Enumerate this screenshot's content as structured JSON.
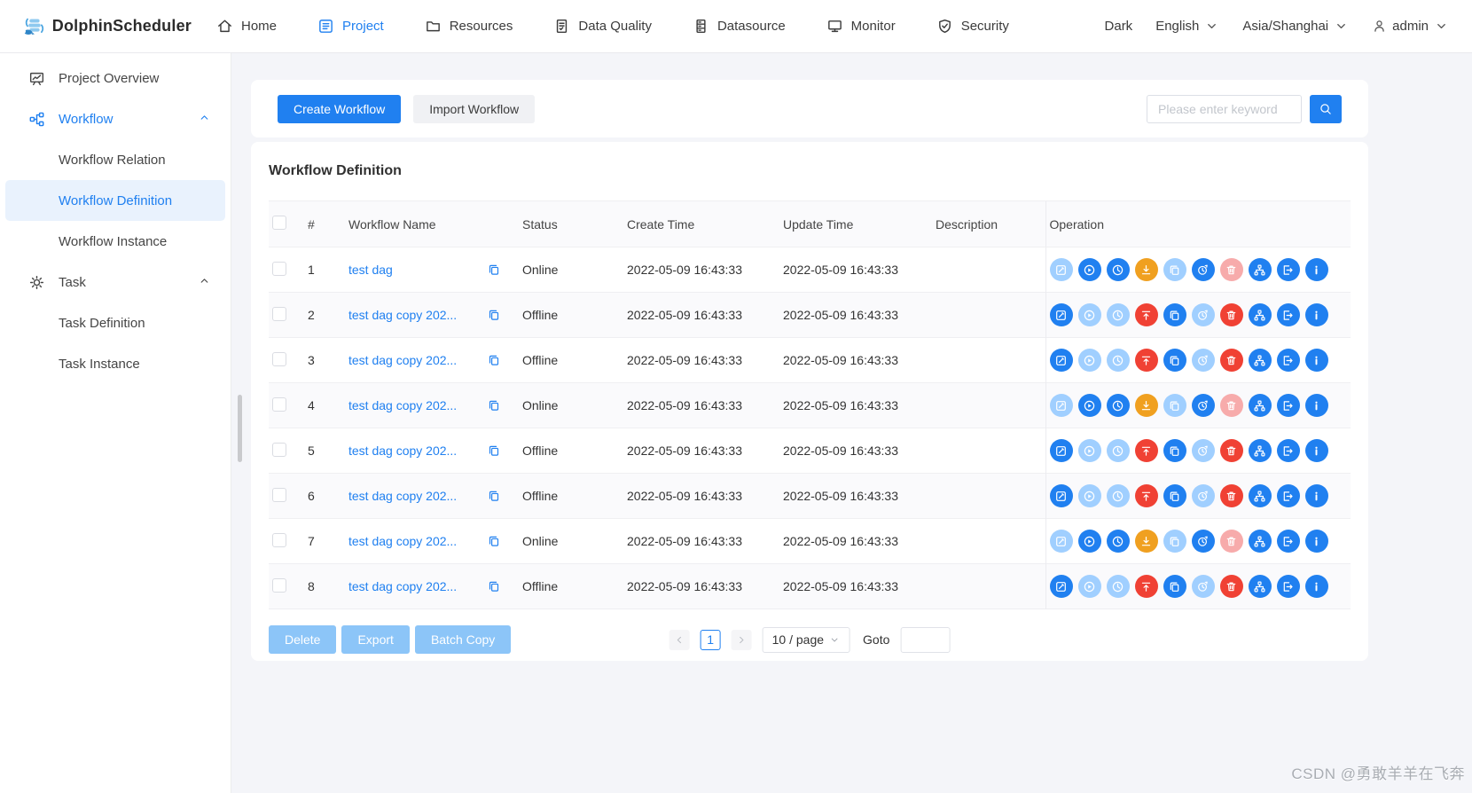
{
  "navbar": {
    "brand": "DolphinScheduler",
    "items": [
      {
        "label": "Home",
        "icon": "home-icon",
        "active": false
      },
      {
        "label": "Project",
        "icon": "project-icon",
        "active": true
      },
      {
        "label": "Resources",
        "icon": "folder-icon",
        "active": false
      },
      {
        "label": "Data Quality",
        "icon": "data-quality-icon",
        "active": false
      },
      {
        "label": "Datasource",
        "icon": "datasource-icon",
        "active": false
      },
      {
        "label": "Monitor",
        "icon": "monitor-icon",
        "active": false
      },
      {
        "label": "Security",
        "icon": "security-icon",
        "active": false
      }
    ],
    "right": {
      "theme": "Dark",
      "language": "English",
      "timezone": "Asia/Shanghai",
      "user": "admin"
    }
  },
  "sidebar": {
    "items": [
      {
        "label": "Project Overview",
        "icon": "project-overview-icon",
        "type": "top",
        "active": false,
        "section_active": false,
        "expandable": false
      },
      {
        "label": "Workflow",
        "icon": "workflow-icon",
        "type": "top",
        "active": false,
        "section_active": true,
        "expandable": true
      },
      {
        "label": "Workflow Relation",
        "type": "sub",
        "active": false
      },
      {
        "label": "Workflow Definition",
        "type": "sub",
        "active": true
      },
      {
        "label": "Workflow Instance",
        "type": "sub",
        "active": false
      },
      {
        "label": "Task",
        "icon": "task-icon",
        "type": "top",
        "active": false,
        "section_active": false,
        "expandable": true
      },
      {
        "label": "Task Definition",
        "type": "sub",
        "active": false
      },
      {
        "label": "Task Instance",
        "type": "sub",
        "active": false
      }
    ]
  },
  "toolbar": {
    "create_label": "Create Workflow",
    "import_label": "Import Workflow",
    "search_placeholder": "Please enter keyword"
  },
  "panel": {
    "title": "Workflow Definition"
  },
  "table": {
    "columns": [
      "#",
      "Workflow Name",
      "Status",
      "Create Time",
      "Update Time",
      "Description",
      "Operation"
    ],
    "rows": [
      {
        "index": "1",
        "name": "test dag",
        "status": "Online",
        "create_time": "2022-05-09 16:43:33",
        "update_time": "2022-05-09 16:43:33",
        "description": ""
      },
      {
        "index": "2",
        "name": "test dag copy 202...",
        "status": "Offline",
        "create_time": "2022-05-09 16:43:33",
        "update_time": "2022-05-09 16:43:33",
        "description": ""
      },
      {
        "index": "3",
        "name": "test dag copy 202...",
        "status": "Offline",
        "create_time": "2022-05-09 16:43:33",
        "update_time": "2022-05-09 16:43:33",
        "description": ""
      },
      {
        "index": "4",
        "name": "test dag copy 202...",
        "status": "Online",
        "create_time": "2022-05-09 16:43:33",
        "update_time": "2022-05-09 16:43:33",
        "description": ""
      },
      {
        "index": "5",
        "name": "test dag copy 202...",
        "status": "Offline",
        "create_time": "2022-05-09 16:43:33",
        "update_time": "2022-05-09 16:43:33",
        "description": ""
      },
      {
        "index": "6",
        "name": "test dag copy 202...",
        "status": "Offline",
        "create_time": "2022-05-09 16:43:33",
        "update_time": "2022-05-09 16:43:33",
        "description": ""
      },
      {
        "index": "7",
        "name": "test dag copy 202...",
        "status": "Online",
        "create_time": "2022-05-09 16:43:33",
        "update_time": "2022-05-09 16:43:33",
        "description": ""
      },
      {
        "index": "8",
        "name": "test dag copy 202...",
        "status": "Offline",
        "create_time": "2022-05-09 16:43:33",
        "update_time": "2022-05-09 16:43:33",
        "description": ""
      }
    ]
  },
  "operations": {
    "online_row": {
      "icons": [
        "edit-icon",
        "start-icon",
        "timing-icon",
        "offline-icon",
        "copy-icon",
        "cron-manage-icon",
        "delete-icon",
        "tree-view-icon",
        "export-icon",
        "version-info-icon"
      ],
      "colors": [
        "disabled_blue",
        "blue",
        "blue",
        "yellow",
        "disabled_blue",
        "blue",
        "disabled_red",
        "blue",
        "blue",
        "blue"
      ]
    },
    "offline_row": {
      "icons": [
        "edit-icon",
        "start-icon",
        "timing-icon",
        "online-icon",
        "copy-icon",
        "cron-manage-icon",
        "delete-icon",
        "tree-view-icon",
        "export-icon",
        "version-info-icon"
      ],
      "colors": [
        "blue",
        "disabled_blue",
        "disabled_blue",
        "red",
        "blue",
        "disabled_blue",
        "red",
        "blue",
        "blue",
        "blue"
      ]
    }
  },
  "footer": {
    "delete_label": "Delete",
    "export_label": "Export",
    "batch_copy_label": "Batch Copy"
  },
  "pagination": {
    "current_page": "1",
    "page_size": "10 / page",
    "goto_label": "Goto"
  },
  "watermark": "CSDN @勇敢羊羊在飞奔",
  "colors": {
    "blue": "#2080f0",
    "disabled_blue": "#a0cfff",
    "yellow": "#f0a020",
    "red": "#f04134",
    "disabled_red": "#f7abab",
    "sidebar_active_bg": "#e9f2fd",
    "disabled_primary_button": "#8cc5f8"
  }
}
